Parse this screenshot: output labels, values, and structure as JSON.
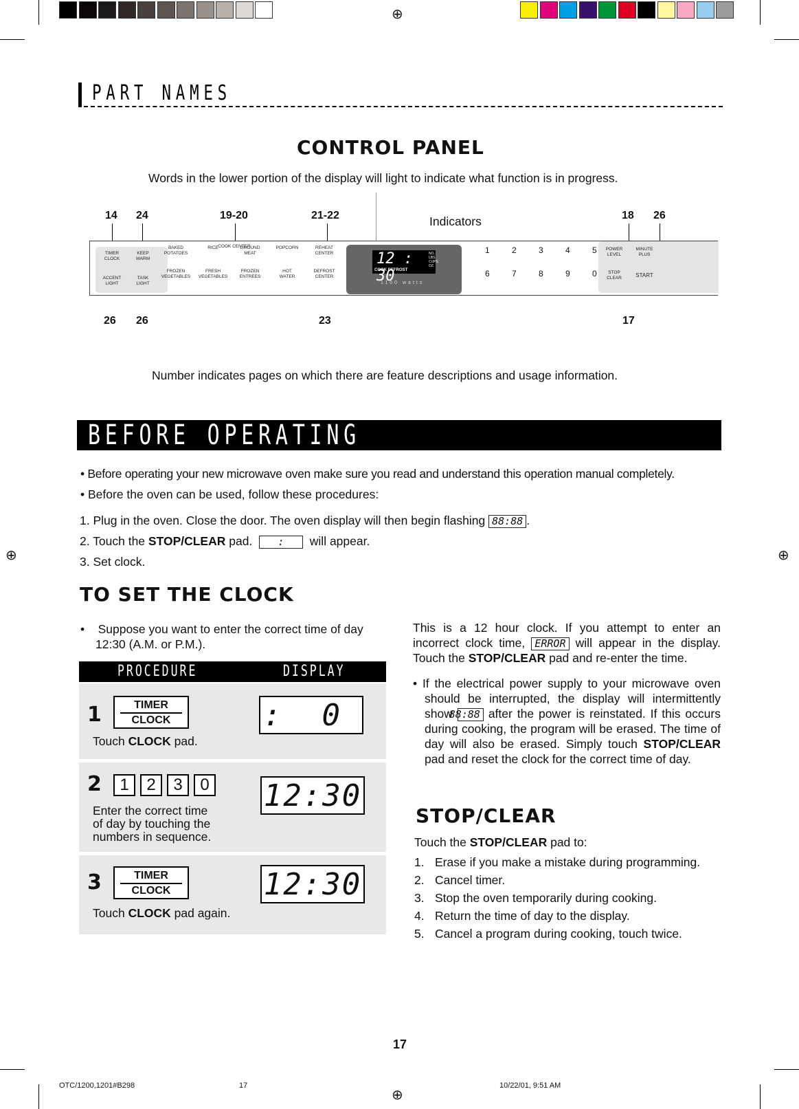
{
  "registration": {
    "gray_swatches": [
      "#000000",
      "#0b0708",
      "#1c1a18",
      "#302826",
      "#48403c",
      "#5e5550",
      "#7d736e",
      "#9b918b",
      "#b8b1ab",
      "#dcd8d5",
      "#ffffff"
    ],
    "color_swatches": [
      "#f7f005",
      "#e0037c",
      "#00a0e6",
      "#371069",
      "#009639",
      "#dd0021",
      "#000000",
      "#fff7a2",
      "#f6a9c1",
      "#98cff0",
      "#9c9c9c"
    ]
  },
  "header": {
    "section_title": "PART NAMES"
  },
  "control_panel": {
    "title": "CONTROL PANEL",
    "caption_top": "Words in the lower portion of the display will light to indicate what function is in progress.",
    "indicators_label": "Indicators",
    "page_refs_top": [
      "14",
      "24",
      "19-20",
      "21-22",
      "18",
      "26"
    ],
    "page_refs_bottom": [
      "26",
      "26",
      "23",
      "17"
    ],
    "caption_bottom": "Number indicates pages on which there are feature descriptions and usage information.",
    "cook_center": "COOK CENTER",
    "left_keys": [
      [
        "TIMER",
        "CLOCK"
      ],
      [
        "KEEP",
        "WARM"
      ],
      [
        "ACCENT",
        "LIGHT"
      ],
      [
        "TASK",
        "LIGHT"
      ]
    ],
    "center_keys_top": [
      [
        "BAKED",
        "POTATOES"
      ],
      [
        "RICE",
        ""
      ],
      [
        "GROUND",
        "MEAT"
      ],
      [
        "POPCORN",
        ""
      ],
      [
        "REHEAT",
        "CENTER"
      ]
    ],
    "center_keys_bottom": [
      [
        "FROZEN",
        "VEGETABLES"
      ],
      [
        "FRESH",
        "VEGETABLES"
      ],
      [
        "FROZEN",
        "ENTREES"
      ],
      [
        "HOT",
        "WATER"
      ],
      [
        "DEFROST",
        "CENTER"
      ]
    ],
    "display_time": "12 : 30",
    "display_units": [
      "NO.",
      "LBS.",
      "CUPS",
      "OZ."
    ],
    "display_words": "COOK DEFROST",
    "wattage": "1100 watts",
    "number_keys": [
      "1",
      "2",
      "3",
      "4",
      "5",
      "6",
      "7",
      "8",
      "9",
      "0"
    ],
    "right_keys": [
      [
        "POWER",
        "LEVEL"
      ],
      [
        "MINUTE",
        "PLUS"
      ],
      [
        "STOP",
        "CLEAR"
      ],
      [
        "START",
        ""
      ]
    ]
  },
  "before_operating": {
    "title": "BEFORE OPERATING",
    "bullets": [
      "Before operating your new microwave oven make sure you read and understand this operation manual completely.",
      "Before the oven can be used, follow these procedures:"
    ],
    "steps": [
      {
        "n": "1.",
        "text": "Plug in the oven. Close the door. The oven display will then begin flashing",
        "lcd": "88:88",
        "after": "."
      },
      {
        "n": "2.",
        "pre": "Touch the ",
        "bold": "STOP/CLEAR",
        "post": " pad.",
        "lcd": ":",
        "after": "will appear."
      },
      {
        "n": "3.",
        "text": "Set clock."
      }
    ]
  },
  "set_clock": {
    "title": "TO SET THE CLOCK",
    "intro": "Suppose you want to enter the correct time of day 12:30 (A.M. or P.M.).",
    "col_procedure": "PROCEDURE",
    "col_display": "DISPLAY",
    "rows": [
      {
        "step": "1",
        "pad": [
          "TIMER",
          "CLOCK"
        ],
        "pre": "Touch ",
        "bold": "CLOCK",
        "post": " pad.",
        "display": ":  0"
      },
      {
        "step": "2",
        "keys": [
          "1",
          "2",
          "3",
          "0"
        ],
        "text": [
          "Enter the correct time",
          "of day by touching the",
          "numbers in sequence."
        ],
        "display": "12:30"
      },
      {
        "step": "3",
        "pad": [
          "TIMER",
          "CLOCK"
        ],
        "pre": "Touch ",
        "bold": "CLOCK",
        "post": " pad again.",
        "display": "12:30"
      }
    ],
    "note1_a": "This is a 12 hour clock. If you attempt to enter an incorrect clock time,",
    "note1_lcd": "ERROR",
    "note1_b": "will appear in the display. Touch the ",
    "note1_bold": "STOP/CLEAR",
    "note1_c": " pad and re-enter the time.",
    "note2_a": "If the electrical power supply to your microwave oven should be interrupted, the display will intermittently show",
    "note2_lcd": "88:88",
    "note2_b": "after the power is reinstated. If this occurs during cooking, the program will be erased. The time of day will also be erased. Simply touch ",
    "note2_bold": "STOP/CLEAR",
    "note2_c": " pad and reset the clock for the correct time of day."
  },
  "stop_clear": {
    "title": "STOP/CLEAR",
    "intro_pre": "Touch the ",
    "intro_bold": "STOP/CLEAR",
    "intro_post": " pad to:",
    "items": [
      {
        "n": "1.",
        "t": "Erase if you make a mistake during programming."
      },
      {
        "n": "2.",
        "t": "Cancel timer."
      },
      {
        "n": "3.",
        "t": "Stop the oven temporarily during cooking."
      },
      {
        "n": "4.",
        "t": "Return the time of day to the display."
      },
      {
        "n": "5.",
        "t": "Cancel a program during cooking, touch twice."
      }
    ]
  },
  "footer": {
    "page_number": "17",
    "slug": "OTC/1200,1201#B298",
    "slug_page": "17",
    "date": "10/22/01, 9:51 AM"
  }
}
